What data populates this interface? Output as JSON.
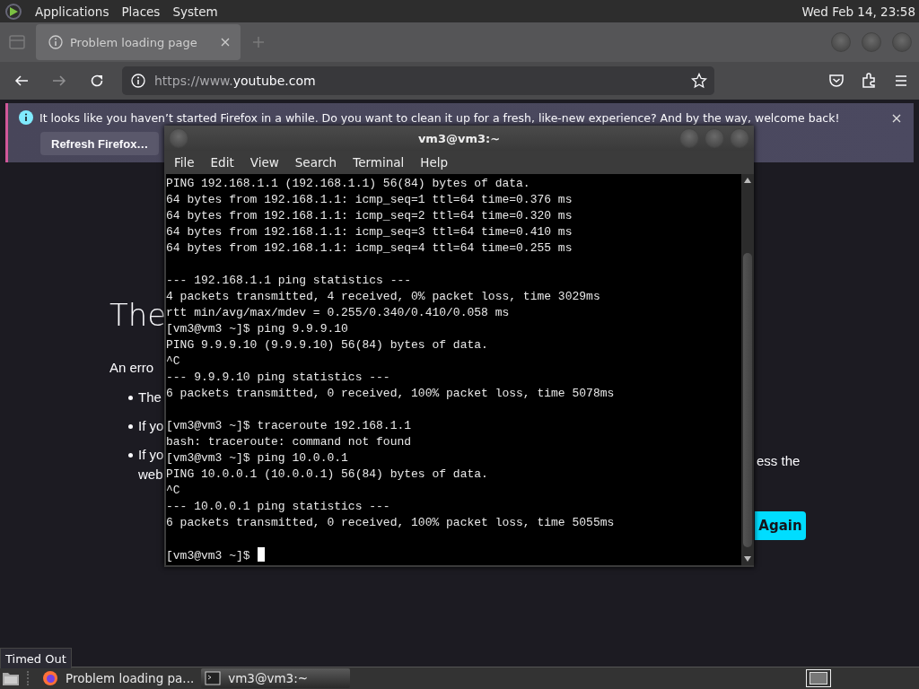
{
  "top_panel": {
    "menus": [
      "Applications",
      "Places",
      "System"
    ],
    "clock": "Wed Feb 14, 23:58"
  },
  "browser": {
    "tab": {
      "title": "Problem loading page",
      "selected": true
    },
    "nav": {
      "forward_disabled": true
    },
    "url": {
      "prefix": "https://www.",
      "domain": "youtube.com"
    },
    "notification": {
      "message": "It looks like you haven’t started Firefox in a while. Do you want to clean it up for a fresh, like-new experience? And by the way, welcome back!",
      "button": "Refresh Firefox…"
    },
    "page": {
      "heading": "The",
      "intro": "An erro",
      "bullets": [
        "The",
        "If yo",
        "If yo web"
      ],
      "right_text": "ess the",
      "button": "Again"
    },
    "status": "Timed Out"
  },
  "terminal": {
    "title": "vm3@vm3:~",
    "menu": [
      "File",
      "Edit",
      "View",
      "Search",
      "Terminal",
      "Help"
    ],
    "blocks": [
      [
        "PING 192.168.1.1 (192.168.1.1) 56(84) bytes of data.",
        "64 bytes from 192.168.1.1: icmp_seq=1 ttl=64 time=0.376 ms",
        "64 bytes from 192.168.1.1: icmp_seq=2 ttl=64 time=0.320 ms",
        "64 bytes from 192.168.1.1: icmp_seq=3 ttl=64 time=0.410 ms",
        "64 bytes from 192.168.1.1: icmp_seq=4 ttl=64 time=0.255 ms"
      ],
      [
        "--- 192.168.1.1 ping statistics ---",
        "4 packets transmitted, 4 received, 0% packet loss, time 3029ms",
        "rtt min/avg/max/mdev = 0.255/0.340/0.410/0.058 ms",
        "[vm3@vm3 ~]$ ping 9.9.9.10",
        "PING 9.9.9.10 (9.9.9.10) 56(84) bytes of data.",
        "^C",
        "--- 9.9.9.10 ping statistics ---",
        "6 packets transmitted, 0 received, 100% packet loss, time 5078ms"
      ],
      [
        "[vm3@vm3 ~]$ traceroute 192.168.1.1",
        "bash: traceroute: command not found",
        "[vm3@vm3 ~]$ ping 10.0.0.1",
        "PING 10.0.0.1 (10.0.0.1) 56(84) bytes of data.",
        "^C",
        "--- 10.0.0.1 ping statistics ---",
        "6 packets transmitted, 0 received, 100% packet loss, time 5055ms"
      ]
    ],
    "prompt": "[vm3@vm3 ~]$"
  },
  "taskbar": {
    "tasks": [
      {
        "kind": "firefox",
        "label": "Problem loading pa...",
        "selected": false
      },
      {
        "kind": "terminal",
        "label": "vm3@vm3:~",
        "selected": true
      }
    ]
  }
}
